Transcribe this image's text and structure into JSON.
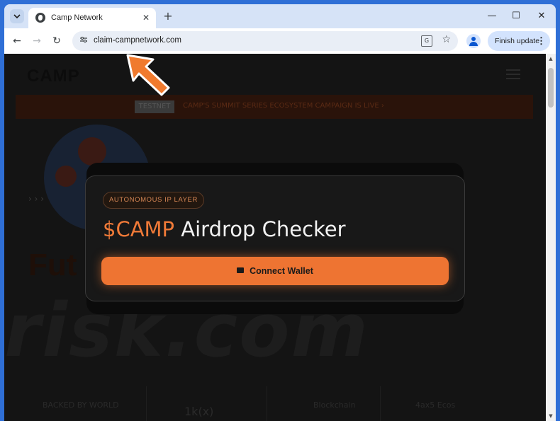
{
  "browser": {
    "tab_title": "Camp Network",
    "new_tab_symbol": "+",
    "tab_close_symbol": "✕",
    "url": "claim-campnetwork.com",
    "update_label": "Finish update",
    "controls": {
      "minimize": "—",
      "maximize": "☐",
      "close": "✕"
    },
    "nav": {
      "back": "←",
      "forward": "→",
      "reload": "↻"
    }
  },
  "background_site": {
    "logo": "CAMP",
    "banner_pill": "TESTNET",
    "banner_text": "CAMP'S SUMMIT SERIES ECOSYSTEM CAMPAIGN IS LIVE  ›",
    "chevrons": "› › ›",
    "hero_fragment": "Fut",
    "watermark": "risk.com",
    "footer_items": [
      "BACKED BY WORLD",
      "1k(x)",
      "Blockchain",
      "4ax5 Ecos"
    ]
  },
  "modal": {
    "badge": "AUTONOMOUS IP LAYER",
    "title_accent": "$CAMP",
    "title_rest": " Airdrop Checker",
    "button_label": "Connect Wallet"
  },
  "colors": {
    "accent": "#ee7432",
    "page_bg": "#141414",
    "chrome_bg": "#d6e3f7"
  }
}
